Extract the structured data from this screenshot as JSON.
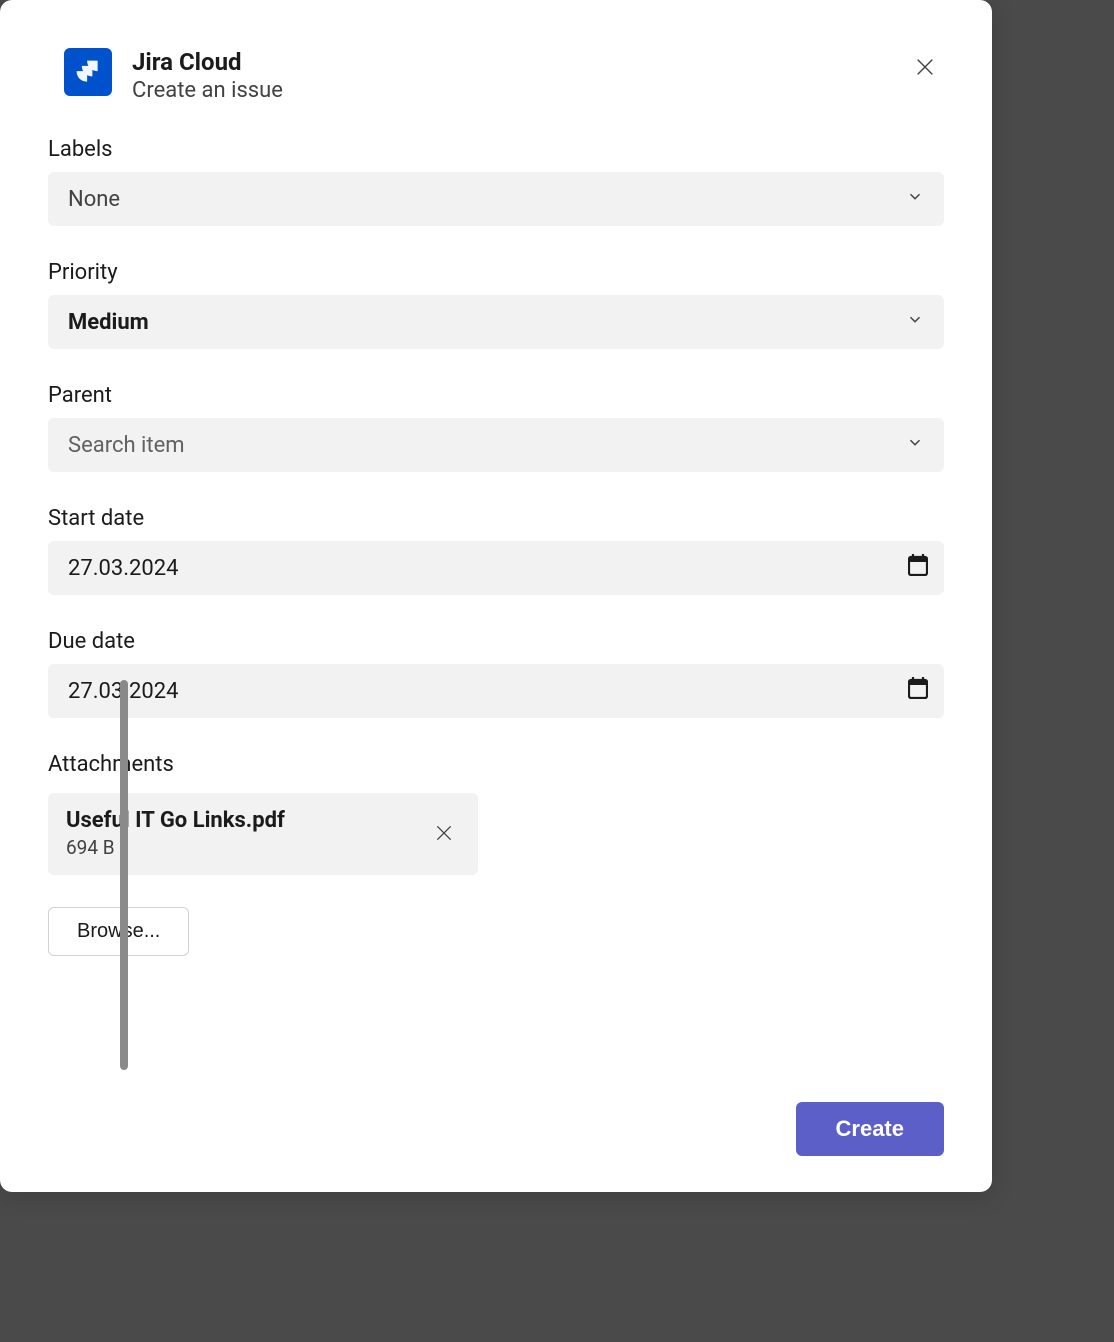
{
  "header": {
    "title": "Jira Cloud",
    "subtitle": "Create an issue"
  },
  "fields": {
    "labels": {
      "label": "Labels",
      "value": "None"
    },
    "priority": {
      "label": "Priority",
      "value": "Medium"
    },
    "parent": {
      "label": "Parent",
      "placeholder": "Search item"
    },
    "start_date": {
      "label": "Start date",
      "value": "27.03.2024"
    },
    "due_date": {
      "label": "Due date",
      "value": "27.03.2024"
    },
    "attachments": {
      "label": "Attachments",
      "files": [
        {
          "name": "Useful IT Go Links.pdf",
          "size": "694 B"
        }
      ]
    }
  },
  "actions": {
    "browse": "Browse...",
    "create": "Create"
  }
}
